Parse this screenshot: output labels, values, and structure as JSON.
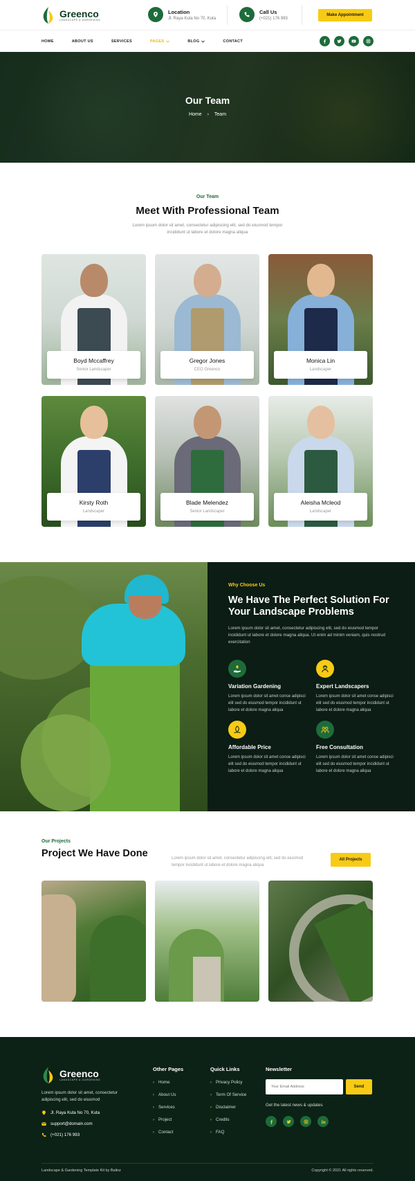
{
  "brand": {
    "name": "Greenco",
    "tagline": "LANDSCAPE & GARDENING"
  },
  "header": {
    "location_label": "Location",
    "location_value": "Jl. Raya Kuta No 70, Kuta",
    "call_label": "Call Us",
    "call_value": "(+021) 176 993",
    "appointment_button": "Make Appointment"
  },
  "nav": {
    "items": [
      {
        "label": "HOME"
      },
      {
        "label": "ABOUT US"
      },
      {
        "label": "SERVICES"
      },
      {
        "label": "PAGES"
      },
      {
        "label": "BLOG"
      },
      {
        "label": "CONTACT"
      }
    ],
    "active": "PAGES"
  },
  "hero": {
    "title": "Our Team",
    "breadcrumb_home": "Home",
    "breadcrumb_sep": "›",
    "breadcrumb_current": "Team"
  },
  "team": {
    "eyebrow": "Our Team",
    "title": "Meet With Professional Team",
    "lead": "Lorem ipsum dolor sit amet, consectetur adipiscing elit, sed do eiusmod tempor incididunt ut labore et dolore magna aliqua",
    "members": [
      {
        "name": "Boyd Mccaffrey",
        "role": "Senior Landscaper"
      },
      {
        "name": "Gregor Jones",
        "role": "CEO Greenco"
      },
      {
        "name": "Monica Lin",
        "role": "Landscaper"
      },
      {
        "name": "Kirsty Roth",
        "role": "Landscaper"
      },
      {
        "name": "Blade Melendez",
        "role": "Senior Landscaper"
      },
      {
        "name": "Aleisha Mcleod",
        "role": "Landscaper"
      }
    ]
  },
  "why": {
    "eyebrow": "Why Choose Us",
    "title": "We Have The Perfect Solution For Your Landscape Problems",
    "lead": "Lorem ipsum dolor sit amet, consectetur adipiscing elit, sed do eiusmod tempor incididunt ut labore et dolore magna aliqua. Ut enim ad minim veniam, quis nostrud exercitation",
    "features": [
      {
        "title": "Variation Gardening",
        "desc": "Lorem ipsum dolor sit amet conse adipisci elit sed do eiusmod tempor incididunt ut labore et dolore magna aliqua"
      },
      {
        "title": "Expert Landscapers",
        "desc": "Lorem ipsum dolor sit amet conse adipisci elit sed do eiusmod tempor incididunt ut labore et dolore magna aliqua"
      },
      {
        "title": "Affordable Price",
        "desc": "Lorem ipsum dolor sit amet conse adipisci elit sed do eiusmod tempor incididunt ut labore et dolore magna aliqua"
      },
      {
        "title": "Free Consultation",
        "desc": "Lorem ipsum dolor sit amet conse adipisci elit sed do eiusmod tempor incididunt ut labore et dolore magna aliqua"
      }
    ]
  },
  "projects": {
    "eyebrow": "Our Projects",
    "title": "Project We Have Done",
    "lead": "Lorem ipsum dolor sit amet, consectetur adipiscing elit, sed do eiusmod tempor incididunt ut labore et dolore magna aliqua",
    "button": "All Projects"
  },
  "footer": {
    "desc": "Lorem ipsum dolor sit amet, consectetur adipiscing elit, sed do eiusmod",
    "address": "Jl. Raya Kuta No 70, Kuta",
    "email": "support@domain.com",
    "phone": "(+021) 176 993",
    "other_pages_title": "Other Pages",
    "other_pages": [
      "Home",
      "About Us",
      "Services",
      "Project",
      "Contact"
    ],
    "quick_links_title": "Quick Links",
    "quick_links": [
      "Privacy Policy",
      "Term Of Service",
      "Disclaimer",
      "Credits",
      "FAQ"
    ],
    "newsletter_title": "Newsletter",
    "newsletter_placeholder": "Your Email Address",
    "newsletter_button": "Send",
    "newsletter_note": "Get the latest news & updates",
    "bottom_left": "Landscape & Gardening Template Kit by Balinz",
    "bottom_right": "Copyright © 2021 All rights reserved."
  },
  "colors": {
    "primary_green": "#1d6b3b",
    "dark_green": "#0b1d14",
    "accent_yellow": "#f7cb15"
  }
}
